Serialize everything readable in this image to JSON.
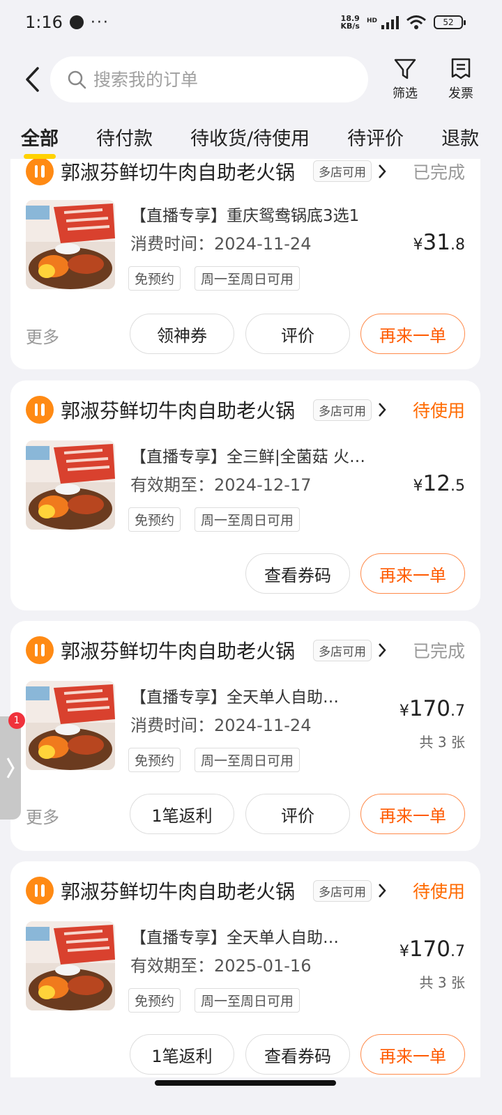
{
  "status_bar": {
    "time": "1:16",
    "more": "···",
    "net_speed_value": "18.9",
    "net_speed_unit": "KB/s",
    "hd": "HD",
    "battery": "52"
  },
  "header": {
    "search_placeholder": "搜索我的订单",
    "filter_label": "筛选",
    "invoice_label": "发票"
  },
  "tabs": [
    {
      "label": "全部",
      "active": true
    },
    {
      "label": "待付款",
      "active": false
    },
    {
      "label": "待收货/待使用",
      "active": false
    },
    {
      "label": "待评价",
      "active": false
    },
    {
      "label": "退款",
      "active": false
    }
  ],
  "orders": [
    {
      "store": "郭淑芬鲜切牛肉自助老火锅",
      "badge": "多店可用",
      "status": "已完成",
      "title": "【直播专享】重庆鸳鸯锅底3选1",
      "meta": "消费时间：2024-11-24",
      "tags": [
        "免预约",
        "周一至周日可用"
      ],
      "price_symbol": "¥",
      "price_int": "31",
      "price_dec": ".8",
      "count": "",
      "more": "更多",
      "buttons": [
        "领神券",
        "评价",
        "再来一单"
      ]
    },
    {
      "store": "郭淑芬鲜切牛肉自助老火锅",
      "badge": "多店可用",
      "status": "待使用",
      "title": "【直播专享】全三鲜|全菌菇 火…",
      "meta": "有效期至：2024-12-17",
      "tags": [
        "免预约",
        "周一至周日可用"
      ],
      "price_symbol": "¥",
      "price_int": "12",
      "price_dec": ".5",
      "count": "",
      "more": "",
      "buttons": [
        "查看券码",
        "再来一单"
      ]
    },
    {
      "store": "郭淑芬鲜切牛肉自助老火锅",
      "badge": "多店可用",
      "status": "已完成",
      "title": "【直播专享】全天单人自助…",
      "meta": "消费时间：2024-11-24",
      "tags": [
        "免预约",
        "周一至周日可用"
      ],
      "price_symbol": "¥",
      "price_int": "170",
      "price_dec": ".7",
      "count": "共 3 张",
      "more": "更多",
      "buttons": [
        "1笔返利",
        "评价",
        "再来一单"
      ]
    },
    {
      "store": "郭淑芬鲜切牛肉自助老火锅",
      "badge": "多店可用",
      "status": "待使用",
      "title": "【直播专享】全天单人自助…",
      "meta": "有效期至：2025-01-16",
      "tags": [
        "免预约",
        "周一至周日可用"
      ],
      "price_symbol": "¥",
      "price_int": "170",
      "price_dec": ".7",
      "count": "共 3 张",
      "more": "",
      "buttons": [
        "1笔返利",
        "查看券码",
        "再来一单"
      ]
    }
  ],
  "side_float": {
    "badge": "1"
  },
  "colors": {
    "accent": "#ff6a00",
    "tab_underline": "#ffd200",
    "store_icon": "#ff8a14"
  }
}
